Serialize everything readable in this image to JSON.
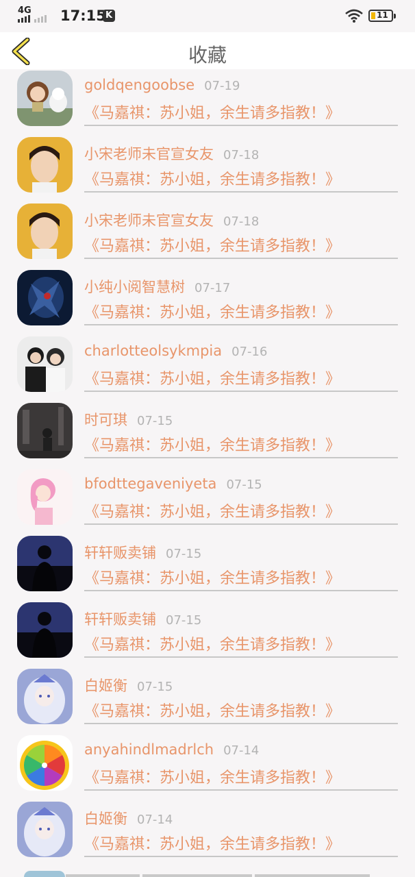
{
  "status_bar": {
    "network": "4G",
    "time": "17:15",
    "notification_badge": "K",
    "battery": "11"
  },
  "nav": {
    "back_icon": "chevron-left-icon",
    "title": "收藏"
  },
  "items": [
    {
      "user": "goldqengoobse",
      "date": "07-19",
      "title": "《马嘉祺：苏小姐，余生请多指教！》",
      "avatar": "cartoon-girl-dog-avatar"
    },
    {
      "user": "小宋老师未官宣女友",
      "date": "07-18",
      "title": "《马嘉祺：苏小姐，余生请多指教！》",
      "avatar": "young-man-portrait-avatar"
    },
    {
      "user": "小宋老师未官宣女友",
      "date": "07-18",
      "title": "《马嘉祺：苏小姐，余生请多指教！》",
      "avatar": "young-man-portrait-avatar"
    },
    {
      "user": "小纯小阅智慧树",
      "date": "07-17",
      "title": "《马嘉祺：苏小姐，余生请多指教！》",
      "avatar": "dark-monster-avatar"
    },
    {
      "user": "charlotteolsykmpia",
      "date": "07-16",
      "title": "《马嘉祺：苏小姐，余生请多指教！》",
      "avatar": "couple-photo-avatar"
    },
    {
      "user": "时可琪",
      "date": "07-15",
      "title": "《马嘉祺：苏小姐，余生请多指教！》",
      "avatar": "dark-street-avatar"
    },
    {
      "user": "bfodttegaveniyeta",
      "date": "07-15",
      "title": "《马嘉祺：苏小姐，余生请多指教！》",
      "avatar": "pink-hair-girl-avatar"
    },
    {
      "user": "轩轩贩卖铺",
      "date": "07-15",
      "title": "《马嘉祺：苏小姐，余生请多指教！》",
      "avatar": "night-silhouette-avatar"
    },
    {
      "user": "轩轩贩卖铺",
      "date": "07-15",
      "title": "《马嘉祺：苏小姐，余生请多指教！》",
      "avatar": "night-silhouette-avatar"
    },
    {
      "user": "白姬衡",
      "date": "07-15",
      "title": "《马嘉祺：苏小姐，余生请多指教！》",
      "avatar": "anime-princess-avatar"
    },
    {
      "user": "anyahindlmadrlch",
      "date": "07-14",
      "title": "《马嘉祺：苏小姐，余生请多指教！》",
      "avatar": "citrus-wheel-avatar"
    },
    {
      "user": "白姬衡",
      "date": "07-14",
      "title": "《马嘉祺：苏小姐，余生请多指教！》",
      "avatar": "anime-princess-avatar"
    }
  ],
  "colors": {
    "accent": "#e8956a",
    "date": "#b3b3b3",
    "title_bar_text": "#666666",
    "background": "#f7f5f6"
  }
}
